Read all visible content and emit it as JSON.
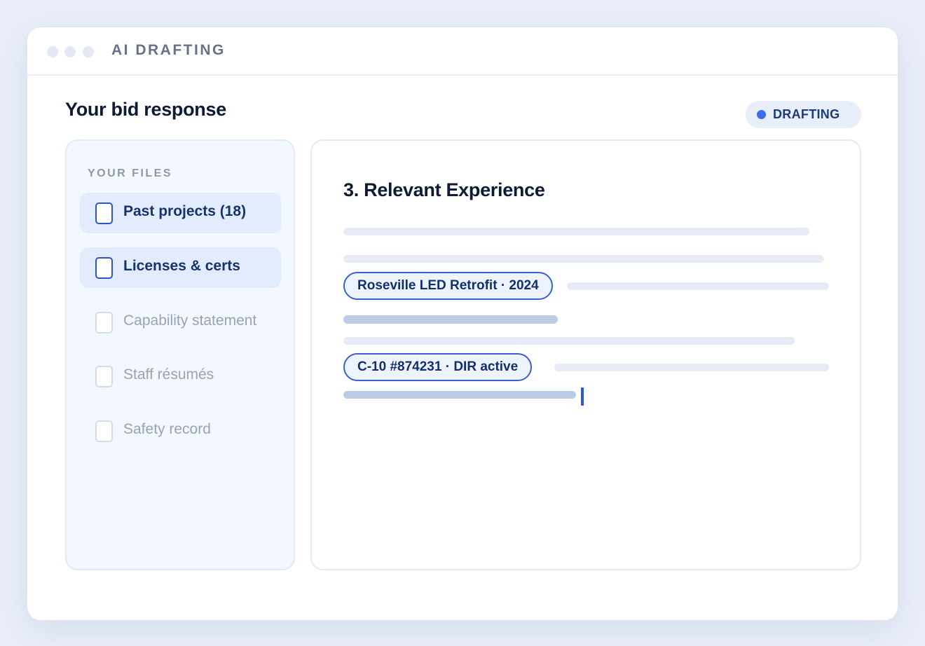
{
  "window": {
    "app_title": "AI DRAFTING"
  },
  "page": {
    "title": "Your bid response"
  },
  "status": {
    "label": "DRAFTING",
    "dot_color": "#3d6cf0"
  },
  "files": {
    "heading": "YOUR FILES",
    "items": [
      {
        "label": "Past projects (18)",
        "checked_style": "active"
      },
      {
        "label": "Licenses & certs",
        "checked_style": "active"
      },
      {
        "label": "Capability statement",
        "checked_style": "inactive"
      },
      {
        "label": "Staff résumés",
        "checked_style": "inactive"
      },
      {
        "label": "Safety record",
        "checked_style": "inactive"
      }
    ]
  },
  "draft": {
    "section_title": "3. Relevant Experience",
    "chips": [
      {
        "label": "Roseville LED Retrofit · 2024"
      },
      {
        "label": "C-10 #874231 · DIR active"
      }
    ]
  },
  "colors": {
    "accent": "#3860cf",
    "background": "#e9eef9",
    "title_text": "#0e1a36"
  }
}
